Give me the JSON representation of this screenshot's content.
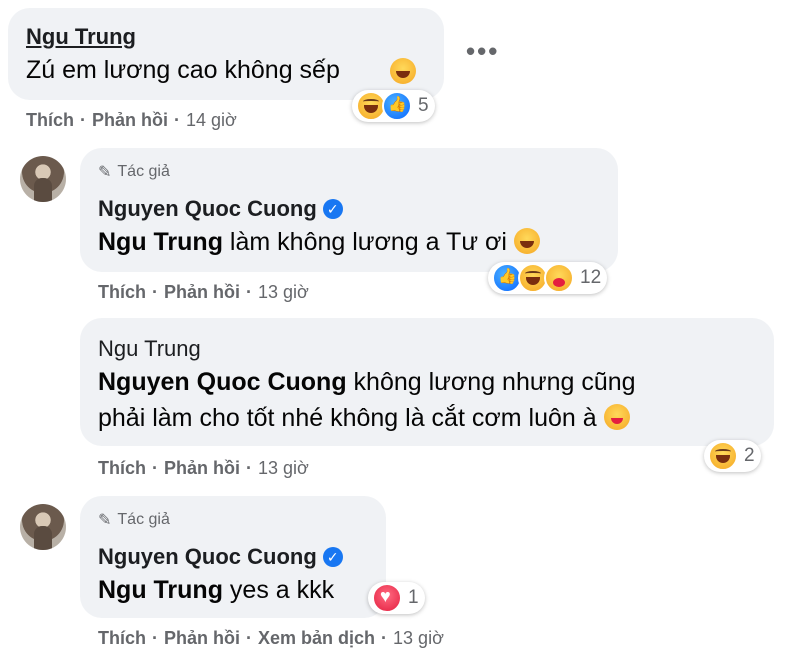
{
  "comments": [
    {
      "author": "Ngu Trung",
      "text": "Zú em lương cao không sếp",
      "reaction_count": "5",
      "actions": {
        "like": "Thích",
        "reply": "Phản hồi",
        "time": "14 giờ"
      }
    },
    {
      "author_badge": "Tác giả",
      "author": "Nguyen Quoc Cuong",
      "mention": "Ngu Trung",
      "text": " làm không lương a Tư ơi",
      "reaction_count": "12",
      "actions": {
        "like": "Thích",
        "reply": "Phản hồi",
        "time": "13 giờ"
      }
    },
    {
      "author": "Ngu Trung",
      "mention": "Nguyen Quoc Cuong",
      "text_line1": " không lương nhưng cũng",
      "text_line2": "phải làm cho tốt nhé không là cắt cơm luôn à",
      "reaction_count": "2",
      "actions": {
        "like": "Thích",
        "reply": "Phản hồi",
        "time": "13 giờ"
      }
    },
    {
      "author_badge": "Tác giả",
      "author": "Nguyen Quoc Cuong",
      "mention": "Ngu Trung",
      "text": " yes a kkk",
      "reaction_count": "1",
      "actions": {
        "like": "Thích",
        "reply": "Phản hồi",
        "translate": "Xem bản dịch",
        "time": "13 giờ"
      }
    }
  ],
  "separator": "·",
  "more_glyph": "•••",
  "colors": {
    "bubble": "#f0f2f5",
    "meta": "#65676b",
    "verified": "#1877f2"
  }
}
